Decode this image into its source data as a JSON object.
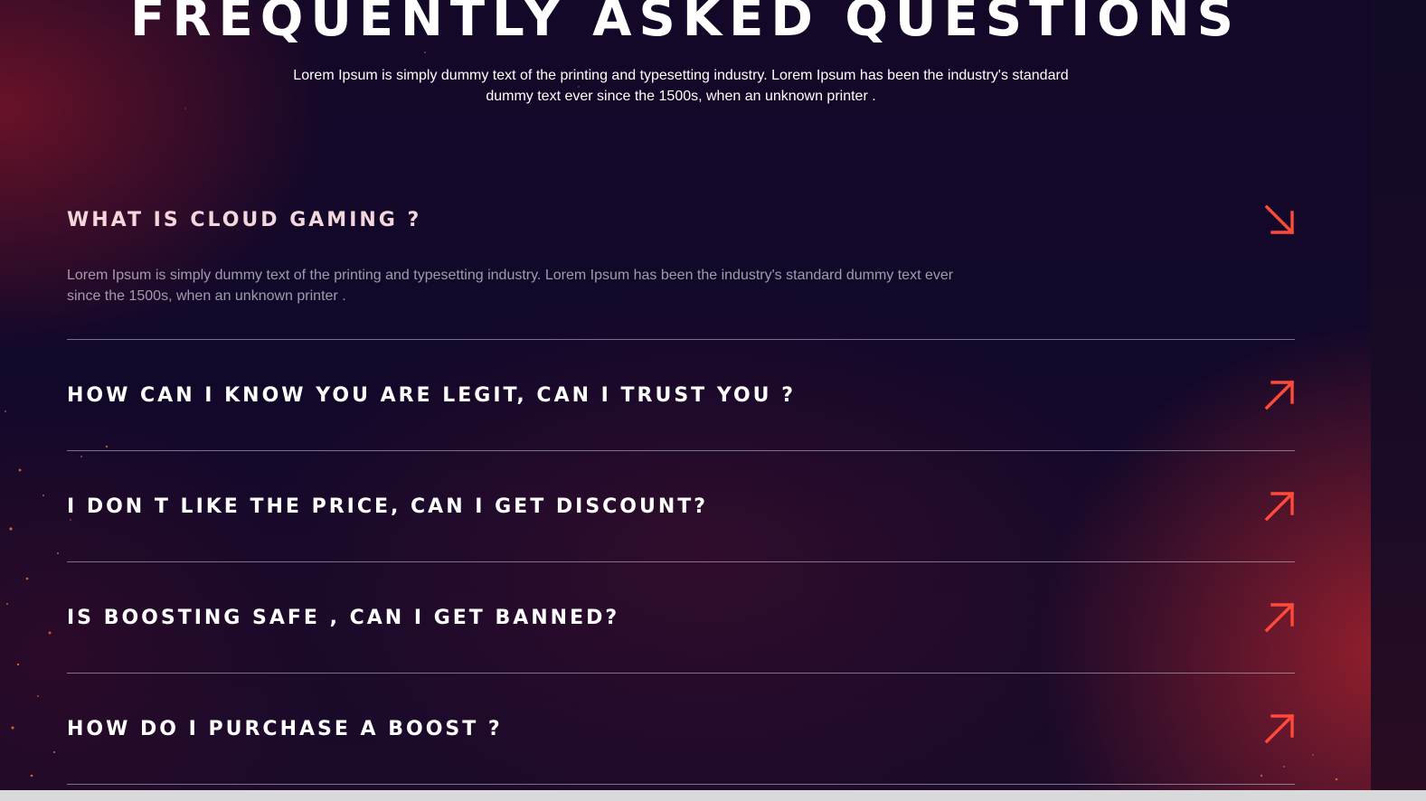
{
  "accent_color": "#ff4a3a",
  "hero": {
    "title": "FREQUENTLY ASKED QUESTIONS",
    "subtitle": "Lorem Ipsum is simply dummy text of the printing and typesetting industry. Lorem Ipsum has been the industry's standard dummy text ever since the 1500s, when an unknown printer ."
  },
  "faq": {
    "items": [
      {
        "question": "WHAT IS CLOUD GAMING ?",
        "answer": "Lorem Ipsum is simply dummy text of the printing and typesetting industry. Lorem Ipsum has been the industry's standard dummy text ever since the 1500s, when an unknown printer .",
        "expanded": true,
        "icon": "arrow-down-right-icon"
      },
      {
        "question": "HOW CAN I KNOW YOU ARE LEGIT, CAN I TRUST YOU ?",
        "expanded": false,
        "icon": "arrow-up-right-icon"
      },
      {
        "question": "I DON T LIKE THE PRICE, CAN I GET DISCOUNT?",
        "expanded": false,
        "icon": "arrow-up-right-icon"
      },
      {
        "question": "IS BOOSTING SAFE , CAN I GET BANNED?",
        "expanded": false,
        "icon": "arrow-up-right-icon"
      },
      {
        "question": "HOW DO I PURCHASE A BOOST ?",
        "expanded": false,
        "icon": "arrow-up-right-icon"
      }
    ]
  }
}
